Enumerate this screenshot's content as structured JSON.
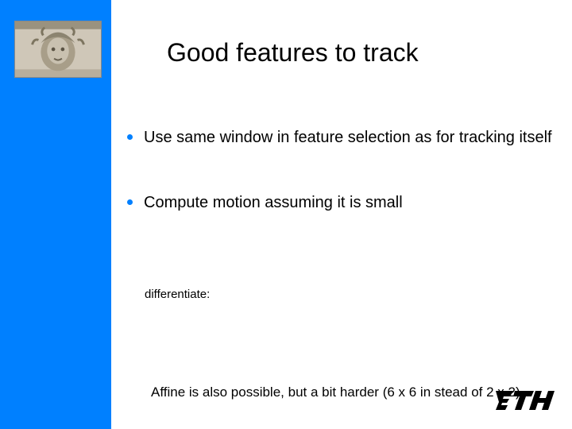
{
  "title": "Good features to track",
  "bullets": [
    "Use same window in feature selection as for tracking itself",
    "Compute motion assuming it is small"
  ],
  "sub": "differentiate:",
  "foot": "Affine is also possible, but a bit harder (6 x 6 in stead of 2 x 2)",
  "icons": {
    "logo": "medusa-relief",
    "brand": "eth-logo"
  }
}
